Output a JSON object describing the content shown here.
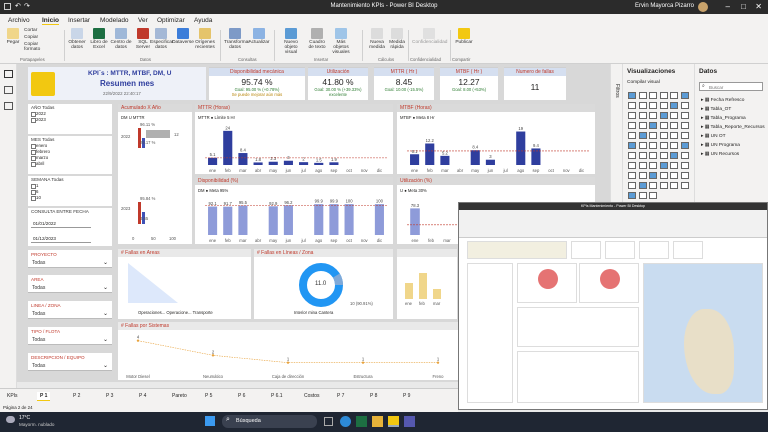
{
  "window": {
    "title": "Mantenimiento KPIs - Power BI Desktop",
    "user": "Ervin Mayorca Pizarro"
  },
  "ribbon_tabs": [
    "Archivo",
    "Inicio",
    "Insertar",
    "Modelado",
    "Ver",
    "Optimizar",
    "Ayuda"
  ],
  "ribbon_buttons": [
    "Pegar",
    "Cortar",
    "Copiar",
    "Copiar formato",
    "Obtener datos",
    "Libro de Excel",
    "Centro de datos",
    "SQL Server",
    "Especificar datos",
    "Dataverse",
    "Orígenes recientes",
    "Transformar datos",
    "Actualizar",
    "Nuevo objeto visual",
    "Cuadro de texto",
    "Más objetos visuales",
    "Nueva medida",
    "Medida rápida",
    "Confidencialidad",
    "Publicar"
  ],
  "ribbon_groups": [
    "Portapapeles",
    "Datos",
    "Consultas",
    "Insertar",
    "Cálculos",
    "Confidencialidad",
    "Compartir"
  ],
  "report": {
    "title": "KPI´s : MTTR, MTBF, DM, U",
    "subtitle": "Resumen mes",
    "date": "22/9/2022 22:40:17",
    "kpis": [
      {
        "label": "Disponibilidad mecánica",
        "value": "95.74 %",
        "sub": "Goal: 95.00 % (+0.78%)",
        "note": "Se puede mejorar aún más"
      },
      {
        "label": "Utilización",
        "value": "41.80 %",
        "sub": "Goal: 30.00 % (+39.33%)",
        "note": "excelente"
      },
      {
        "label": "MTTR ( Hr )",
        "value": "8.45",
        "sub": "Goal: 10.00 (-15.5%)"
      },
      {
        "label": "MTBF ( Hr )",
        "value": "12.27",
        "sub": "Goal: 8.00 (+53%)"
      },
      {
        "label": "Numero de fallas",
        "value": "11"
      }
    ]
  },
  "slicers": {
    "year": {
      "label": "AÑO Todas",
      "items": [
        "2022",
        "2023"
      ]
    },
    "month": {
      "label": "MES Todas",
      "items": [
        "enero",
        "febrero",
        "marzo",
        "abril"
      ]
    },
    "week": {
      "label": "SEMANA Todas",
      "items": [
        "1",
        "6",
        "10"
      ]
    },
    "range": {
      "label": "CONSULTA ENTRE FECHA",
      "from": "01/01/2022",
      "to": "01/12/2023"
    },
    "dropdowns": [
      {
        "label": "PROYECTO",
        "value": "Todas"
      },
      {
        "label": "AREA",
        "value": "Todas"
      },
      {
        "label": "LINEA / ZONA",
        "value": "Todas"
      },
      {
        "label": "TIPO / FLOTA",
        "value": "Todas"
      },
      {
        "label": "DESCRIPCION / EQUIPO",
        "value": "Todas"
      }
    ]
  },
  "charts": {
    "acumulado": {
      "title": "Acumulado X Año",
      "legend": [
        "DM",
        "U",
        "MTTR"
      ],
      "years": [
        "2022",
        "2023"
      ],
      "labels": [
        "96.11 %",
        "29.17 %",
        "95.84 %",
        "3.65",
        "12"
      ],
      "xticks": [
        "0",
        "50",
        "100"
      ]
    },
    "mttr": {
      "title": "MTTR (Horas)",
      "legend": [
        "MTTR",
        "Límite 5 Hr"
      ],
      "months": [
        "ene",
        "feb",
        "mar",
        "abr",
        "may",
        "jun",
        "jul",
        "ago",
        "sep",
        "oct",
        "nov",
        "dic"
      ],
      "values": [
        5.1,
        24.0,
        8.4,
        1.8,
        2.3,
        3.0,
        2.0,
        1.5,
        1.9,
        null,
        null,
        null
      ]
    },
    "mtbf": {
      "title": "MTBF (Horas)",
      "legend": [
        "MTBF",
        "Meta 8 Hr"
      ],
      "months": [
        "ene",
        "feb",
        "mar",
        "abr",
        "may",
        "jun",
        "jul",
        "ago",
        "sep",
        "oct",
        "nov",
        "dic"
      ],
      "values": [
        6.1,
        12.2,
        5.2,
        null,
        8.4,
        3.0,
        null,
        19.0,
        9.4,
        null,
        null,
        null
      ]
    },
    "disp": {
      "title": "Disponibilidad (%)",
      "legend": [
        "DM",
        "Meta 95%"
      ],
      "months": [
        "ene",
        "feb",
        "mar",
        "abr",
        "may",
        "jun",
        "jul",
        "ago",
        "sep",
        "oct",
        "nov",
        "dic"
      ],
      "values": [
        92.1,
        91.7,
        95.5,
        null,
        92.9,
        96.2,
        null,
        99.9,
        99.9,
        100.0,
        null,
        100.0
      ]
    },
    "util": {
      "title": "Utilización (%)",
      "legend": [
        "U",
        "Meta 30%"
      ],
      "months": [
        "ene",
        "feb",
        "mar",
        "abr"
      ],
      "values": [
        78.3,
        null,
        null,
        null
      ]
    },
    "areas": {
      "title": "# Fallas en Areas",
      "legend": [
        "Operaciones...",
        "Operacione...",
        "Transporte"
      ]
    },
    "lineas": {
      "title": "# Fallas en Líneas / Zona",
      "center": "11.0",
      "outer": "10 (90.91%)",
      "legend": [
        "Interior mina",
        "Cantera"
      ]
    },
    "third": {
      "months": [
        "ene",
        "feb",
        "mar"
      ]
    },
    "sistemas": {
      "title": "# Fallas por Sistemas",
      "categories": [
        "Motor Diesel",
        "Neumático",
        "Caja de dirección",
        "Estructura",
        "Freno"
      ],
      "values": [
        4,
        2,
        1,
        1,
        1
      ]
    }
  },
  "pane_vis": {
    "title": "Visualizaciones",
    "sub": "Compilar visual"
  },
  "pane_data": {
    "title": "Datos",
    "search": "Buscar",
    "tables": [
      "Fecha Refresco",
      "Tabla_OT",
      "Tabla_Programa",
      "Tabla_Reporte_Recursos",
      "UN OT",
      "UN Programa",
      "UN Recursos"
    ]
  },
  "pages": [
    "KPIs",
    "P 1",
    "P 2",
    "P 3",
    "P 4",
    "Pareto",
    "P 5",
    "P 6",
    "P 6.1",
    "Costos",
    "P 7",
    "P 8",
    "P 9"
  ],
  "active_page": "P 1",
  "status": "Página 2 de 24",
  "taskbar": {
    "temp": "17°C",
    "weather": "Mayorm. nublado",
    "search": "Búsqueda"
  },
  "second_window": {
    "title": "KPIs Mantenimiento - Power BI Desktop"
  }
}
